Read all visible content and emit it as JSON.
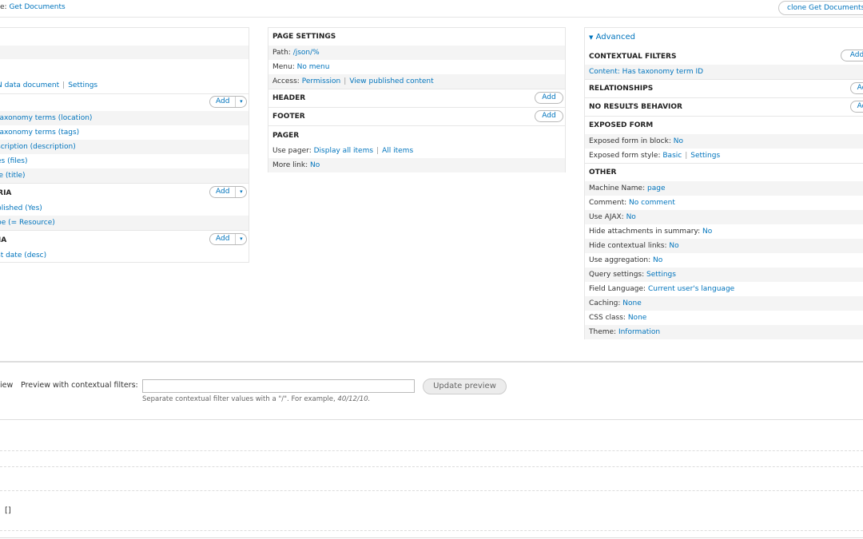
{
  "topbar": {
    "display_label": "e:",
    "display_value": "Get Documents",
    "clone_button": "clone Get Documents"
  },
  "left": {
    "rows": [
      {
        "text": "N data document",
        "extra": "Settings"
      }
    ],
    "fields": [
      "taxonomy terms (location)",
      "taxonomy terms (tags)",
      "scription (description)",
      "es (files)",
      "le (title)"
    ],
    "filter_heading": "ERIA",
    "filters": [
      "blished (Yes)",
      "pe (= Resource)"
    ],
    "sort_heading": "RIA",
    "sorts": [
      "st date (desc)"
    ],
    "add": "Add",
    "caret": "▾"
  },
  "middle": {
    "page_settings": "PAGE SETTINGS",
    "path_label": "Path:",
    "path_value": "/json/%",
    "menu_label": "Menu:",
    "menu_value": "No menu",
    "access_label": "Access:",
    "access_value": "Permission",
    "access_extra": "View published content",
    "header": "HEADER",
    "footer": "FOOTER",
    "pager": "PAGER",
    "use_pager_label": "Use pager:",
    "use_pager_value": "Display all items",
    "use_pager_extra": "All items",
    "more_link_label": "More link:",
    "more_link_value": "No",
    "add": "Add"
  },
  "right": {
    "advanced": "Advanced",
    "contextual_filters": "CONTEXTUAL FILTERS",
    "contextual_value": "Content: Has taxonomy term ID",
    "relationships": "RELATIONSHIPS",
    "no_results": "NO RESULTS BEHAVIOR",
    "exposed_form": "EXPOSED FORM",
    "exposed_block_label": "Exposed form in block:",
    "exposed_block_value": "No",
    "exposed_style_label": "Exposed form style:",
    "exposed_style_value": "Basic",
    "exposed_style_extra": "Settings",
    "other": "OTHER",
    "other_rows": [
      {
        "label": "Machine Name:",
        "value": "page"
      },
      {
        "label": "Comment:",
        "value": "No comment"
      },
      {
        "label": "Use AJAX:",
        "value": "No"
      },
      {
        "label": "Hide attachments in summary:",
        "value": "No"
      },
      {
        "label": "Hide contextual links:",
        "value": "No"
      },
      {
        "label": "Use aggregation:",
        "value": "No"
      },
      {
        "label": "Query settings:",
        "value": "Settings"
      },
      {
        "label": "Field Language:",
        "value": "Current user's language"
      },
      {
        "label": "Caching:",
        "value": "None"
      },
      {
        "label": "CSS class:",
        "value": "None"
      },
      {
        "label": "Theme:",
        "value": "Information"
      }
    ],
    "add": "Add",
    "add_cut": "Ad"
  },
  "preview": {
    "view_label": "iew",
    "contextual_label": "Preview with contextual filters:",
    "input_value": "",
    "help_text": "Separate contextual filter values with a \"/\". For example,",
    "help_example": "40/12/10.",
    "update_button": "Update preview"
  },
  "output": {
    "brackets": "[]"
  }
}
